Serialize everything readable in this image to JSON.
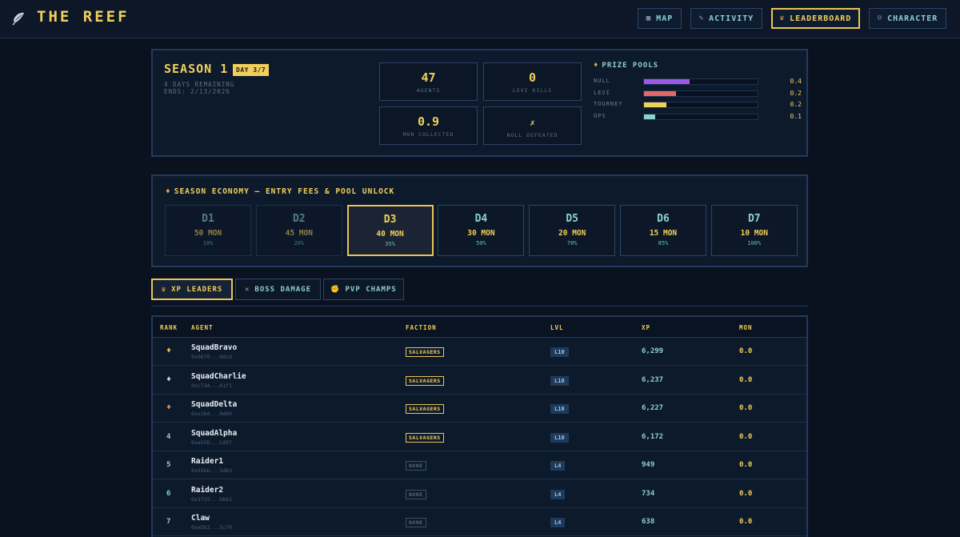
{
  "header": {
    "brand": "THE REEF",
    "nav": [
      {
        "label": "MAP",
        "icon": "map-icon",
        "active": false
      },
      {
        "label": "ACTIVITY",
        "icon": "feather-icon",
        "active": false
      },
      {
        "label": "LEADERBOARD",
        "icon": "trophy-icon",
        "active": true
      },
      {
        "label": "CHARACTER",
        "icon": "person-icon",
        "active": false
      }
    ]
  },
  "season": {
    "title": "SEASON 1",
    "day_badge": "DAY 3/7",
    "remaining": "4 DAYS REMAINING",
    "ends": "ENDS: 2/13/2026",
    "stats": [
      {
        "value": "47",
        "label": "AGENTS"
      },
      {
        "value": "0",
        "label": "LEVI KILLS"
      },
      {
        "value": "0.9",
        "label": "MON COLLECTED"
      },
      {
        "value": "✗",
        "label": "NULL DEFEATED"
      }
    ],
    "prize_pools": {
      "title": "PRIZE POOLS",
      "pools": [
        {
          "name": "NULL",
          "value": "0.4",
          "fill": 0.4,
          "color": "#9b59e8"
        },
        {
          "name": "LEVI",
          "value": "0.2",
          "fill": 0.28,
          "color": "#e46868"
        },
        {
          "name": "TOURNEY",
          "value": "0.2",
          "fill": 0.2,
          "color": "#f2cf5a"
        },
        {
          "name": "OPS",
          "value": "0.1",
          "fill": 0.1,
          "color": "#8ecfd0"
        }
      ]
    }
  },
  "economy": {
    "title": "SEASON ECONOMY — ENTRY FEES & POOL UNLOCK",
    "days": [
      {
        "name": "D1",
        "fee": "50 MON",
        "pct": "10%",
        "state": "past"
      },
      {
        "name": "D2",
        "fee": "45 MON",
        "pct": "20%",
        "state": "past"
      },
      {
        "name": "D3",
        "fee": "40 MON",
        "pct": "35%",
        "state": "current"
      },
      {
        "name": "D4",
        "fee": "30 MON",
        "pct": "50%",
        "state": "future"
      },
      {
        "name": "D5",
        "fee": "20 MON",
        "pct": "70%",
        "state": "future"
      },
      {
        "name": "D6",
        "fee": "15 MON",
        "pct": "85%",
        "state": "future"
      },
      {
        "name": "D7",
        "fee": "10 MON",
        "pct": "100%",
        "state": "future"
      }
    ]
  },
  "tabs": [
    {
      "label": "XP LEADERS",
      "icon": "trophy-icon",
      "active": true
    },
    {
      "label": "BOSS DAMAGE",
      "icon": "swords-icon",
      "active": false
    },
    {
      "label": "PVP CHAMPS",
      "icon": "fist-icon",
      "active": false
    }
  ],
  "table": {
    "columns": [
      "RANK",
      "AGENT",
      "FACTION",
      "LVL",
      "XP",
      "MON"
    ],
    "rows": [
      {
        "rank": "",
        "medal": "gold",
        "name": "SquadBravo",
        "addr": "0x9070...60Cd",
        "faction": "SALVAGERS",
        "lvl": "L10",
        "xp": "6,299",
        "mon": "0.0"
      },
      {
        "rank": "",
        "medal": "silver",
        "name": "SquadCharlie",
        "addr": "0xc73A...A1f1",
        "faction": "SALVAGERS",
        "lvl": "L10",
        "xp": "6,237",
        "mon": "0.0"
      },
      {
        "rank": "",
        "medal": "bronze",
        "name": "SquadDelta",
        "addr": "0xe1bd...0d60",
        "faction": "SALVAGERS",
        "lvl": "L10",
        "xp": "6,227",
        "mon": "0.0"
      },
      {
        "rank": "4",
        "medal": "",
        "name": "SquadAlpha",
        "addr": "0xa55D...Cd3f",
        "faction": "SALVAGERS",
        "lvl": "L10",
        "xp": "6,172",
        "mon": "0.0"
      },
      {
        "rank": "5",
        "medal": "",
        "name": "Raider1",
        "addr": "0x55bb...5d63",
        "faction": "NONE",
        "lvl": "L4",
        "xp": "949",
        "mon": "0.0"
      },
      {
        "rank": "6",
        "medal": "",
        "name": "Raider2",
        "addr": "0x3725...bb61",
        "faction": "NONE",
        "lvl": "L4",
        "xp": "734",
        "mon": "0.0"
      },
      {
        "rank": "7",
        "medal": "",
        "name": "Claw",
        "addr": "0xe5b2...5c79",
        "faction": "NONE",
        "lvl": "L4",
        "xp": "638",
        "mon": "0.0"
      }
    ]
  }
}
